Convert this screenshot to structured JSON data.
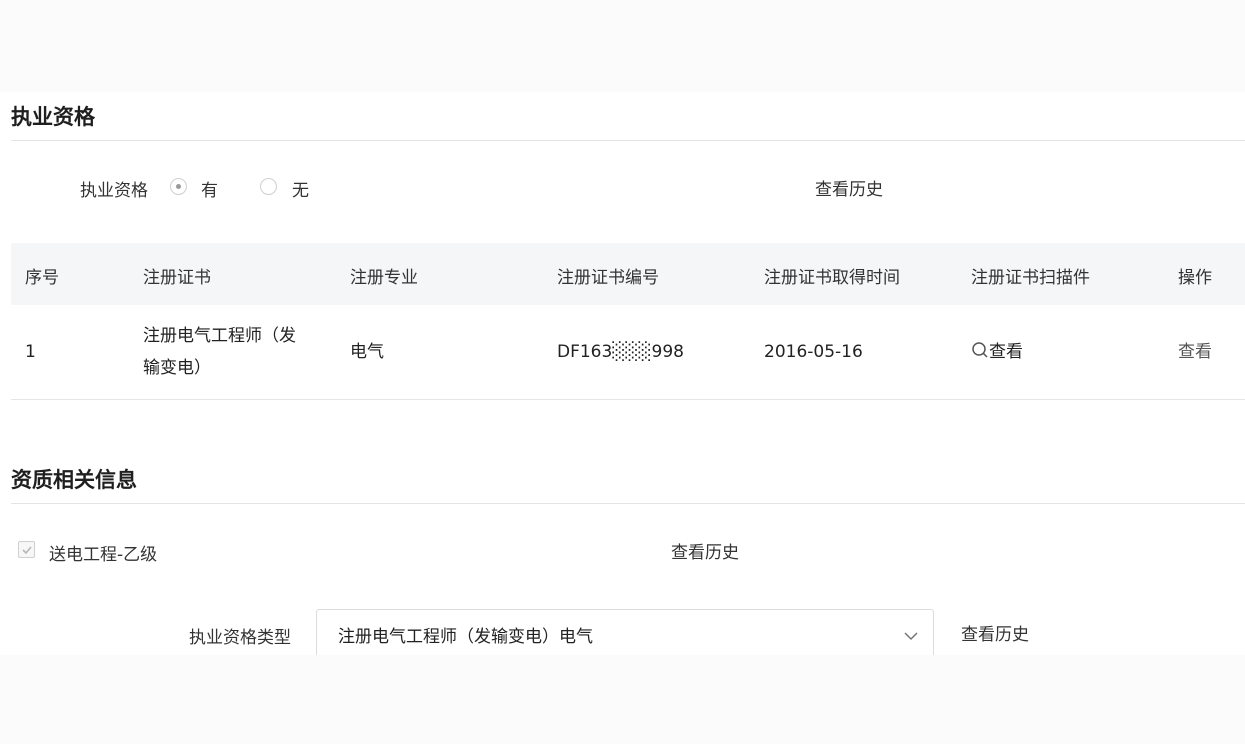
{
  "qualification": {
    "title": "执业资格",
    "field_label": "执业资格",
    "options": [
      "有",
      "无"
    ],
    "selected": "有",
    "history_link": "查看历史"
  },
  "table": {
    "headers": [
      "序号",
      "注册证书",
      "注册专业",
      "注册证书编号",
      "注册证书取得时间",
      "注册证书扫描件",
      "操作"
    ],
    "rows": [
      {
        "index": "1",
        "certificate_line1": "注册电气工程师（发",
        "certificate_line2": "输变电）",
        "major": "电气",
        "cert_number": "DF163░░░998",
        "date": "2016-05-16",
        "scan_label": "查看",
        "action": "查看"
      }
    ]
  },
  "aptitude": {
    "title": "资质相关信息",
    "item_label": "送电工程-乙级",
    "history_link": "查看历史",
    "type_label": "执业资格类型",
    "type_value": "注册电气工程师（发输变电）电气",
    "type_history_link": "查看历史"
  },
  "icons": {
    "search": "search-icon",
    "chevron": "chevron-down-icon",
    "check": "check-icon"
  }
}
